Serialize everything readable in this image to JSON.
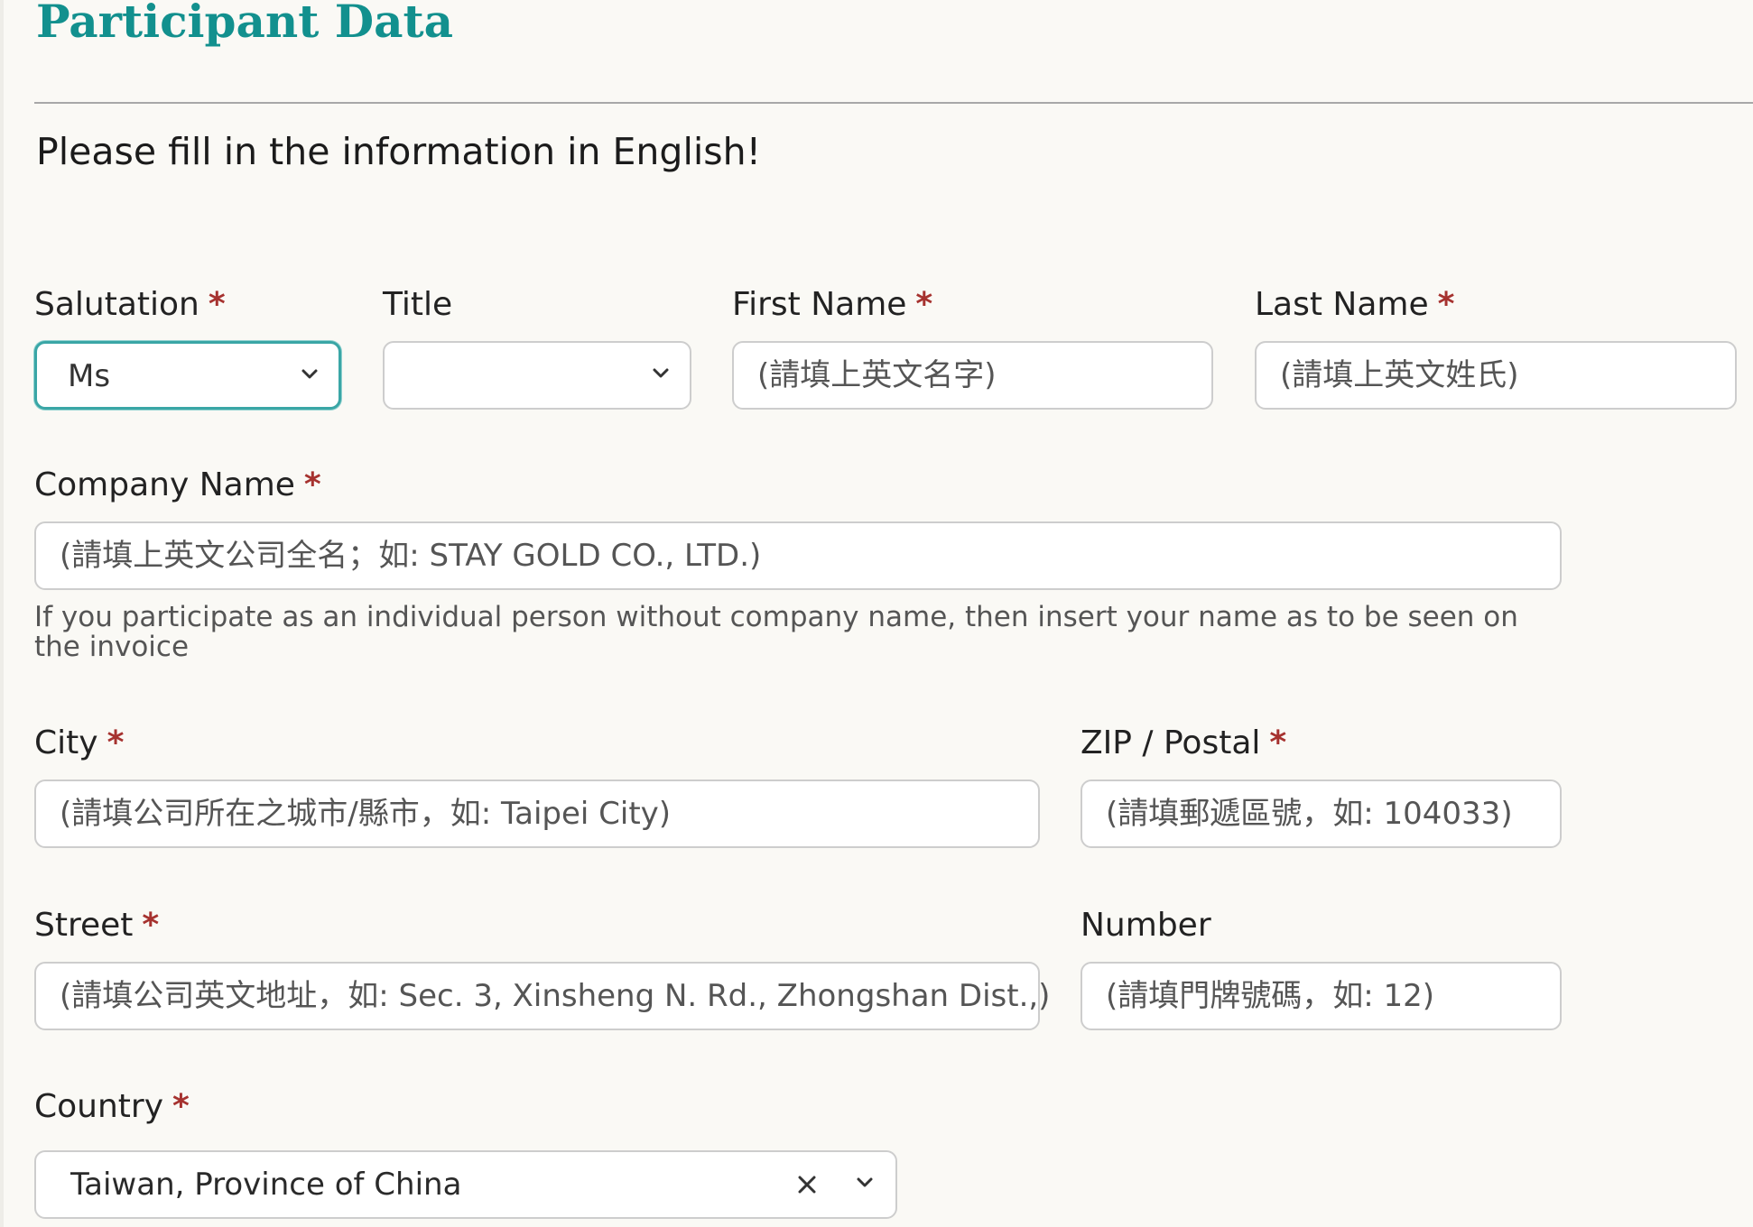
{
  "header": {
    "title": "Participant Data",
    "instruction": "Please fill in the information in English!"
  },
  "form": {
    "required_mark": "*",
    "salutation": {
      "label": "Salutation",
      "value": "Ms"
    },
    "title": {
      "label": "Title",
      "value": ""
    },
    "first_name": {
      "label": "First Name",
      "placeholder": "(請填上英文名字)"
    },
    "last_name": {
      "label": "Last Name",
      "placeholder": "(請填上英文姓氏)"
    },
    "company_name": {
      "label": "Company Name",
      "placeholder": "(請填上英文公司全名；如: STAY GOLD CO., LTD.)",
      "helper": "If you participate as an individual person without company name, then insert your name as to be seen on the invoice"
    },
    "city": {
      "label": "City",
      "placeholder": "(請填公司所在之城市/縣市，如: Taipei City)"
    },
    "zip": {
      "label": "ZIP / Postal",
      "placeholder": "(請填郵遞區號，如: 104033)"
    },
    "street": {
      "label": "Street",
      "placeholder": "(請填公司英文地址，如: Sec. 3, Xinsheng N. Rd., Zhongshan Dist.,)"
    },
    "number": {
      "label": "Number",
      "placeholder": "(請填門牌號碼，如: 12)"
    },
    "country": {
      "label": "Country",
      "value": "Taiwan, Province of China"
    }
  },
  "icons": {
    "chevron": "chevron-down-icon",
    "clear": "close-icon"
  },
  "colors": {
    "title": "#12908e",
    "required": "#a6322f",
    "focus_border": "#3aa6a6",
    "field_border": "#cdcdcd",
    "background": "#faf9f5"
  }
}
